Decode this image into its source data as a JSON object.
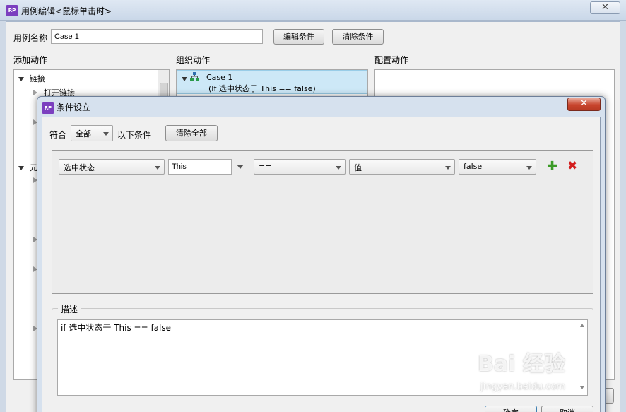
{
  "outer_window": {
    "title": "用例编辑<鼠标单击时>",
    "close_glyph": "✕",
    "case_name_label": "用例名称",
    "case_name_value": "Case 1",
    "edit_condition_button": "编辑条件",
    "clear_condition_button": "清除条件",
    "add_action_heading": "添加动作",
    "organize_action_heading": "组织动作",
    "configure_action_heading": "配置动作",
    "tree": {
      "links_group": "链接",
      "open_link": "打开链接",
      "elements_group_partial": "元"
    },
    "case_item": {
      "name": "Case 1",
      "condition": "(If 选中状态于 This == false)"
    }
  },
  "dialog": {
    "title": "条件设立",
    "close_glyph": "✕",
    "match_label": "符合",
    "match_value": "全部",
    "match_suffix": "以下条件",
    "clear_all_button": "清除全部",
    "condition": {
      "type": "选中状态",
      "target": "This",
      "operator": "==",
      "value_type": "值",
      "value": "false"
    },
    "description_legend": "描述",
    "description_text": "if 选中状态于 This == false",
    "ok_button": "确定",
    "cancel_button": "取消"
  },
  "watermark": {
    "text": "Bai 经验",
    "sub": "jingyan.baidu.com"
  },
  "icons": {
    "app": "rp-app-icon",
    "add_condition": "plus-icon",
    "delete_condition": "x-icon",
    "case": "case-tree-icon"
  },
  "colors": {
    "add_green": "#3a9a26",
    "delete_red": "#d31d1d",
    "selection_blue": "#cde8f7",
    "app_purple": "#7b3fbf"
  }
}
